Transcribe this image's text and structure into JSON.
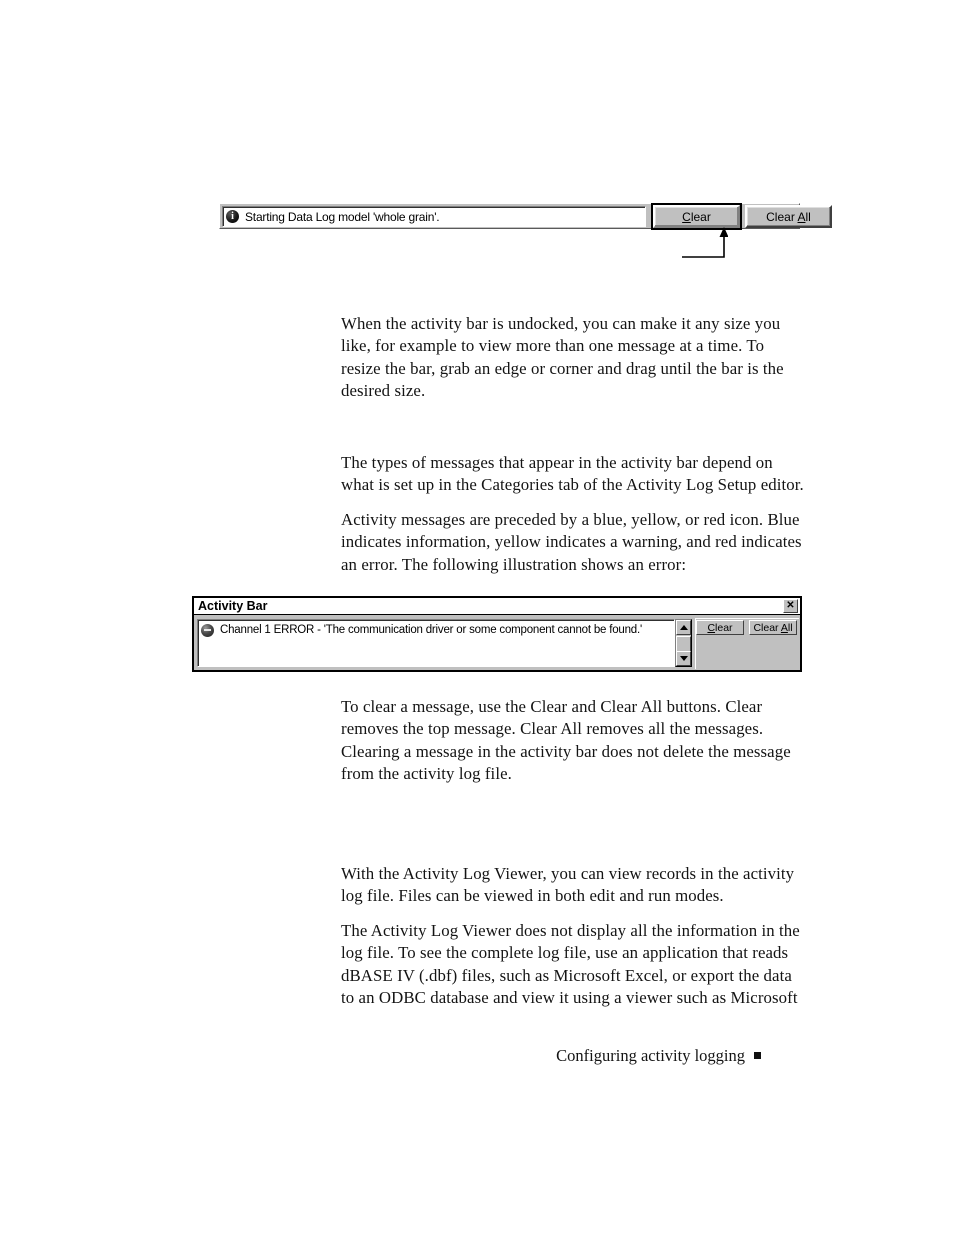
{
  "document": {
    "footer_text": "Configuring activity logging"
  },
  "figure_docked_bar": {
    "message": {
      "icon": "info-circle-icon",
      "text": "Starting Data Log model 'whole grain'."
    },
    "buttons": {
      "clear": "Clear",
      "clear_accel": "C",
      "clear_all": "Clear All",
      "clear_all_accel": "A"
    },
    "callout": "leader-line-to-clear-button"
  },
  "figure_activity_bar_window": {
    "title": "Activity Bar",
    "close_label": "✕",
    "message": {
      "icon": "error-circle-icon",
      "text": "Channel 1 ERROR - 'The communication driver or some component cannot be found.'"
    },
    "buttons": {
      "clear": "Clear",
      "clear_all": "Clear All"
    },
    "scrollbar": {
      "up_arrow": "▲",
      "down_arrow": "▼"
    }
  },
  "paragraphs": {
    "p1": "When the activity bar is undocked, you can make it any size you like, for example to view more than one message at a time. To resize the bar, grab an edge or corner and drag until the bar is the desired size.",
    "p2": "The types of messages that appear in the activity bar depend on what is set up in the Categories tab of the Activity Log Setup editor.",
    "p3": "Activity messages are preceded by a blue, yellow, or red icon. Blue indicates information, yellow indicates a warning, and red indicates an error. The following illustration shows an error:",
    "p4": "To clear a message, use the Clear and Clear All buttons. Clear removes the top message. Clear All removes all the messages. Clearing a message in the activity bar does not delete the message from the activity log file.",
    "p5": "With the Activity Log Viewer, you can view records in the activity log file. Files can be viewed in both edit and run modes.",
    "p6": "The Activity Log Viewer does not display all the information in the log file. To see the complete log file, use an application that reads dBASE IV (.dbf) files, such as Microsoft Excel, or export the data to an ODBC database and view it using a viewer such as Microsoft"
  },
  "colors": {
    "face": "#c0c0c0",
    "window_bg": "#ffffff",
    "text": "#000000",
    "shadow": "#808080"
  }
}
